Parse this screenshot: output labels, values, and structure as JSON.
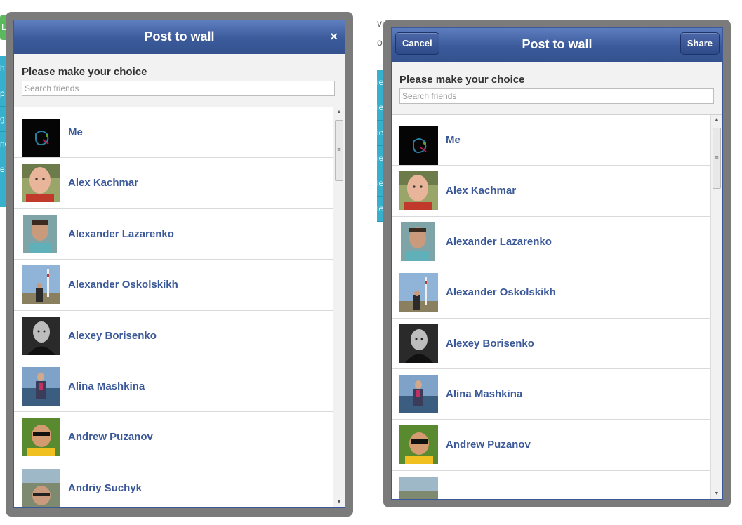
{
  "background": {
    "green_button_text": "Lo",
    "left_strip_texts": [
      "h",
      "p",
      "g",
      "ne",
      "e"
    ],
    "text_width": "vidth",
    "text_logg": "ogg",
    "right_strip_texts": [
      "ien",
      "ien",
      "ien",
      "ien",
      "ien",
      "ien"
    ]
  },
  "dialog_left": {
    "title": "Post to wall",
    "close_label": "×",
    "choice_title": "Please make your choice",
    "search_placeholder": "Search friends",
    "friends": [
      {
        "name": "Me"
      },
      {
        "name": "Alex Kachmar"
      },
      {
        "name": "Alexander Lazarenko"
      },
      {
        "name": "Alexander Oskolskikh"
      },
      {
        "name": "Alexey Borisenko"
      },
      {
        "name": "Alina Mashkina"
      },
      {
        "name": "Andrew Puzanov"
      },
      {
        "name": "Andriy Suchyk"
      }
    ]
  },
  "dialog_right": {
    "title": "Post to wall",
    "cancel_label": "Cancel",
    "share_label": "Share",
    "choice_title": "Please make your choice",
    "search_placeholder": "Search friends",
    "friends": [
      {
        "name": "Me"
      },
      {
        "name": "Alex Kachmar"
      },
      {
        "name": "Alexander Lazarenko"
      },
      {
        "name": "Alexander Oskolskikh"
      },
      {
        "name": "Alexey Borisenko"
      },
      {
        "name": "Alina Mashkina"
      },
      {
        "name": "Andrew Puzanov"
      },
      {
        "name": ""
      }
    ]
  },
  "scrollbar_icons": {
    "up": "arrow-up-icon",
    "down": "arrow-down-icon",
    "grip": "grip-icon"
  },
  "colors": {
    "header": "#3b5998",
    "link": "#3b5998",
    "frame": "#7b7b7b",
    "cyan": "#36b0cc"
  }
}
